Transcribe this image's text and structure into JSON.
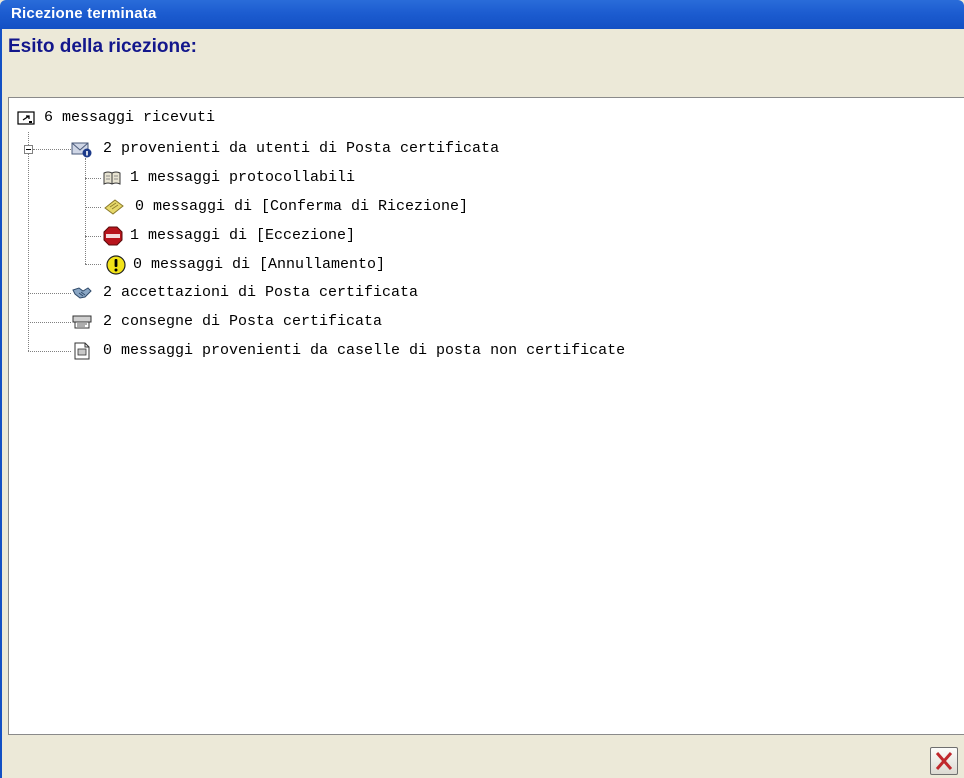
{
  "window": {
    "title": "Ricezione terminata"
  },
  "heading": "Esito della ricezione:",
  "tree": {
    "root": {
      "label": "6 messaggi ricevuti",
      "icon": "window-icon"
    },
    "certified_users": {
      "label": "2 provenienti da utenti di Posta certificata",
      "icon": "certified-mail-icon",
      "expanded": true,
      "children": [
        {
          "label": "1 messaggi protocollabili",
          "icon": "book-icon"
        },
        {
          "label": "0 messaggi di [Conferma di Ricezione]",
          "icon": "note-icon"
        },
        {
          "label": "1 messaggi di [Eccezione]",
          "icon": "stop-sign-icon"
        },
        {
          "label": "0 messaggi di [Annullamento]",
          "icon": "warning-icon"
        }
      ]
    },
    "siblings": [
      {
        "label": "2 accettazioni di Posta certificata",
        "icon": "handshake-icon"
      },
      {
        "label": "2 consegne di Posta certificata",
        "icon": "delivery-icon"
      },
      {
        "label": "0 messaggi provenienti da caselle di posta non certificate",
        "icon": "document-icon"
      }
    ]
  },
  "buttons": {
    "close_icon": "close-icon"
  },
  "colors": {
    "title_bar": "#1350c4",
    "heading": "#13178c",
    "background": "#ece9d8",
    "close_x": "#c0282d"
  }
}
